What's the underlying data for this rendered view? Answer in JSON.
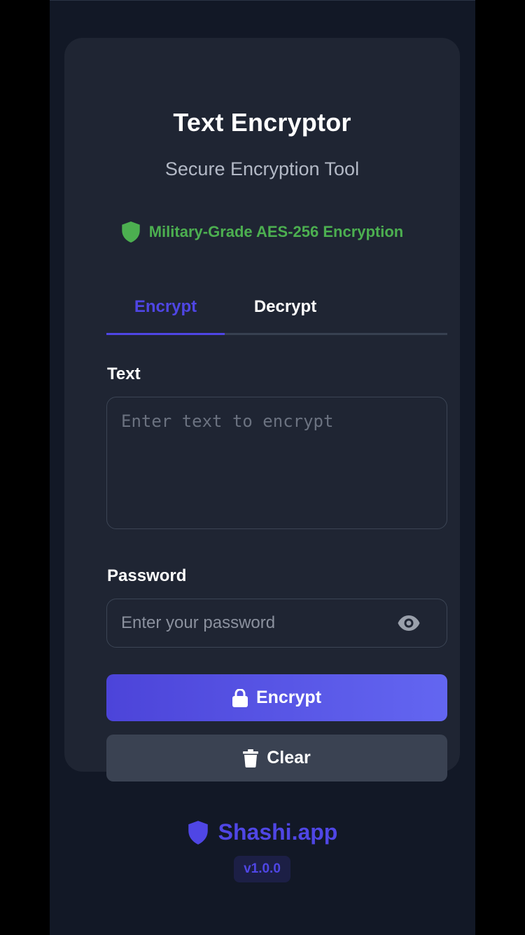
{
  "app": {
    "title": "Text Encryptor",
    "subtitle": "Secure Encryption Tool",
    "badge": "Military-Grade AES-256 Encryption",
    "badge_icon": "shield-icon",
    "badge_color": "#4caf50"
  },
  "tabs": [
    {
      "label": "Encrypt",
      "active": true
    },
    {
      "label": "Decrypt",
      "active": false
    }
  ],
  "text_field": {
    "label": "Text",
    "placeholder": "Enter text to encrypt",
    "value": ""
  },
  "password_field": {
    "label": "Password",
    "placeholder": "Enter your password",
    "value": "",
    "toggle_icon": "eye-icon"
  },
  "buttons": {
    "encrypt": {
      "label": "Encrypt",
      "icon": "lock-icon"
    },
    "clear": {
      "label": "Clear",
      "icon": "trash-icon"
    }
  },
  "footer": {
    "brand": "Shashi.app",
    "brand_icon": "shield-icon",
    "version": "v1.0.0"
  },
  "colors": {
    "accent": "#4f46e5",
    "background": "#121826",
    "card": "#1f2533"
  }
}
